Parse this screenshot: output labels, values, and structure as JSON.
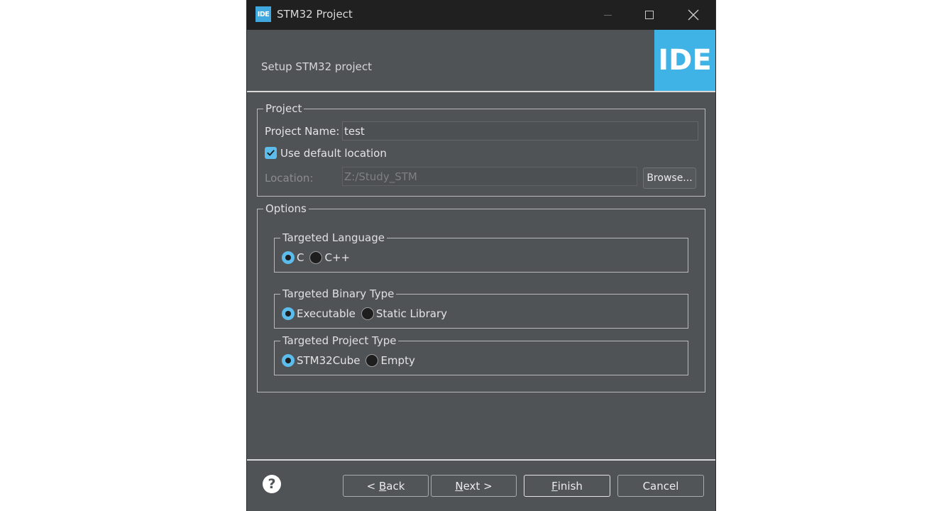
{
  "window": {
    "title": "STM32 Project",
    "app_icon_text": "IDE"
  },
  "banner": {
    "subtitle": "Setup STM32 project",
    "logo_text": "IDE"
  },
  "project": {
    "legend": "Project",
    "name_label": "Project Name:",
    "name_value": "test",
    "use_default_label": "Use default location",
    "use_default_checked": true,
    "location_label": "Location:",
    "location_value": "Z:/Study_STM",
    "browse_label": "Browse..."
  },
  "options": {
    "legend": "Options",
    "language": {
      "legend": "Targeted Language",
      "options": [
        "C",
        "C++"
      ],
      "selected": "C"
    },
    "binary": {
      "legend": "Targeted Binary Type",
      "options": [
        "Executable",
        "Static Library"
      ],
      "selected": "Executable"
    },
    "project_type": {
      "legend": "Targeted Project Type",
      "options": [
        "STM32Cube",
        "Empty"
      ],
      "selected": "STM32Cube"
    }
  },
  "footer": {
    "back_prefix": "< ",
    "back_mnemonic": "B",
    "back_rest": "ack",
    "next_mnemonic": "N",
    "next_rest": "ext >",
    "finish_mnemonic": "F",
    "finish_rest": "inish",
    "cancel_label": "Cancel",
    "help_glyph": "?"
  },
  "colors": {
    "accent": "#5cbcec",
    "logo": "#3fb3e6",
    "background": "#505356",
    "titlebar": "#202020"
  },
  "icons": [
    "help-icon",
    "checkmark-icon",
    "window-minimize-icon",
    "window-maximize-icon",
    "window-close-icon"
  ]
}
